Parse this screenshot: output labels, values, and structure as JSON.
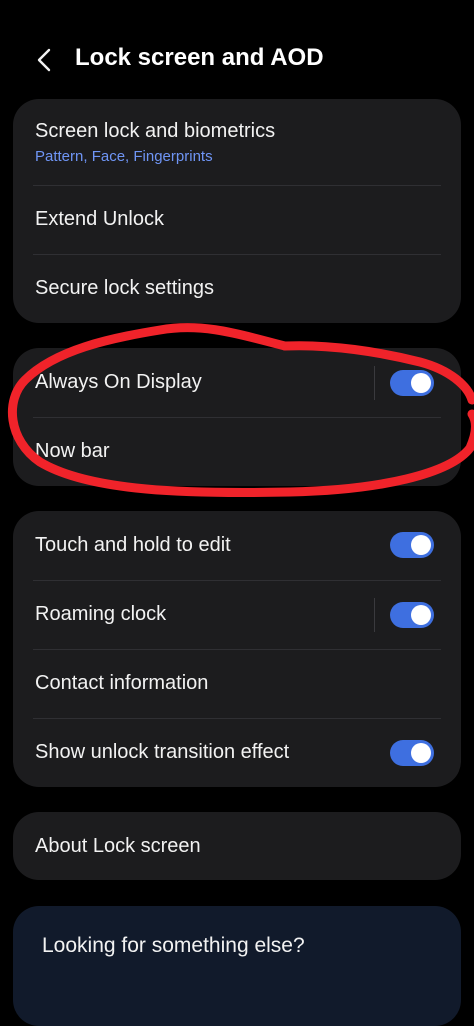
{
  "header": {
    "title": "Lock screen and AOD"
  },
  "security_card": {
    "screen_lock": {
      "label": "Screen lock and biometrics",
      "summary": "Pattern, Face, Fingerprints"
    },
    "extend_unlock": {
      "label": "Extend Unlock"
    },
    "secure_lock": {
      "label": "Secure lock settings"
    }
  },
  "display_card": {
    "aod": {
      "label": "Always On Display",
      "enabled": true
    },
    "now_bar": {
      "label": "Now bar"
    }
  },
  "options_card": {
    "touch_hold": {
      "label": "Touch and hold to edit",
      "enabled": true
    },
    "roaming_clock": {
      "label": "Roaming clock",
      "enabled": true
    },
    "contact_info": {
      "label": "Contact information"
    },
    "unlock_transition": {
      "label": "Show unlock transition effect",
      "enabled": true
    }
  },
  "about_card": {
    "label": "About Lock screen"
  },
  "suggestions": {
    "title": "Looking for something else?"
  },
  "colors": {
    "background": "#000000",
    "card": "#1c1c1e",
    "accent": "#3e6fe0",
    "summary_text": "#6f95f5",
    "annotation_red": "#f0232a"
  },
  "icons": {
    "back": "chevron-left-icon"
  }
}
